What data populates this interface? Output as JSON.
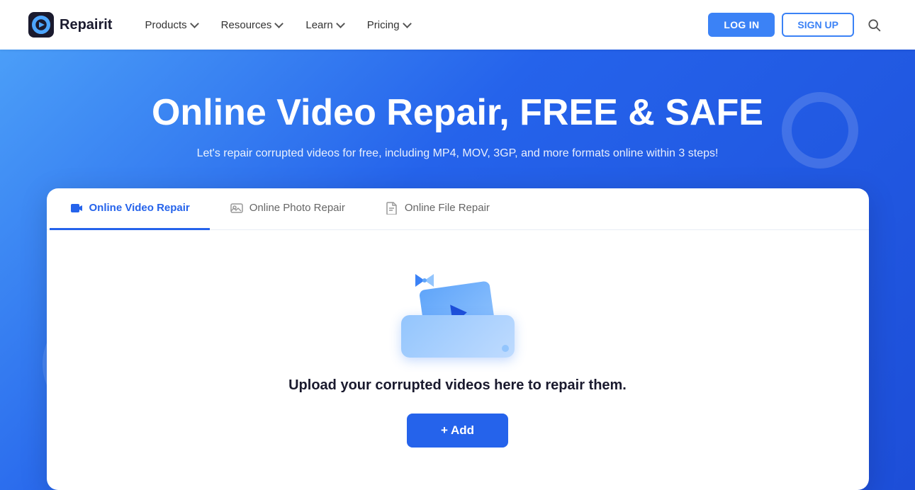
{
  "brand": {
    "logo_text": "Repairit"
  },
  "navbar": {
    "products_label": "Products",
    "resources_label": "Resources",
    "learn_label": "Learn",
    "pricing_label": "Pricing",
    "login_label": "LOG IN",
    "signup_label": "SIGN UP"
  },
  "hero": {
    "title": "Online Video Repair, FREE & SAFE",
    "subtitle": "Let's repair corrupted videos for free, including MP4, MOV, 3GP, and more formats online within 3 steps!"
  },
  "tabs": [
    {
      "id": "video",
      "label": "Online Video Repair",
      "active": true
    },
    {
      "id": "photo",
      "label": "Online Photo Repair",
      "active": false
    },
    {
      "id": "file",
      "label": "Online File Repair",
      "active": false
    }
  ],
  "card": {
    "upload_text": "Upload your corrupted videos here to repair them.",
    "add_button": "+ Add"
  }
}
